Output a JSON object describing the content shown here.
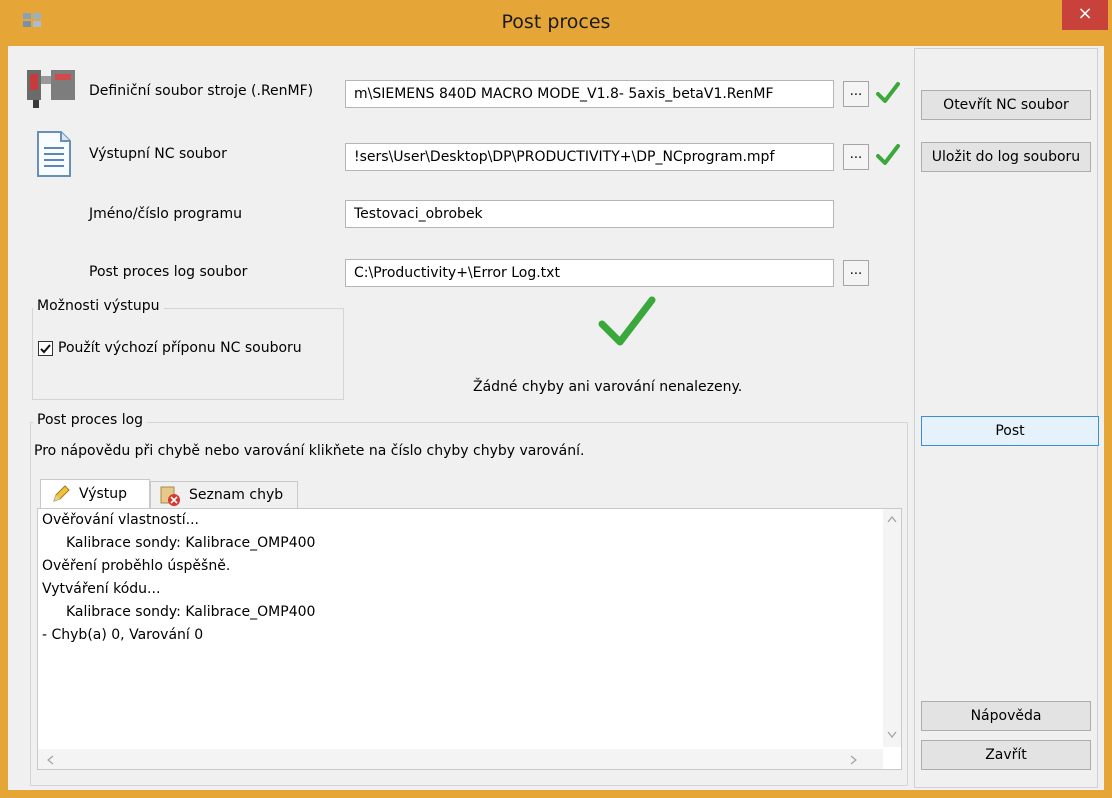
{
  "window": {
    "title": "Post proces",
    "close_label": "×"
  },
  "fields": {
    "machine": {
      "label": "Definiční soubor stroje (.RenMF)",
      "value": "m\\SIEMENS 840D MACRO MODE_V1.8- 5axis_betaV1.RenMF",
      "browse_label": "..."
    },
    "output_nc": {
      "label": "Výstupní NC soubor",
      "value": "!sers\\User\\Desktop\\DP\\PRODUCTIVITY+\\DP_NCprogram.mpf",
      "browse_label": "..."
    },
    "program_name": {
      "label": "Jméno/číslo programu",
      "value": "Testovaci_obrobek"
    },
    "log_file": {
      "label": "Post proces log soubor",
      "value": "C:\\Productivity+\\Error Log.txt",
      "browse_label": "..."
    }
  },
  "output_options": {
    "title": "Možnosti výstupu",
    "checkbox_label": "Použít výchozí příponu NC souboru",
    "checked": true
  },
  "status": {
    "message": "Žádné chyby ani varování nenalezeny."
  },
  "buttons": {
    "open_nc": "Otevřít NC soubor",
    "save_log": "Uložit do log souboru",
    "post": "Post",
    "help": "Nápověda",
    "close": "Zavřít"
  },
  "log": {
    "title": "Post proces log",
    "hint": "Pro nápovědu při chybě nebo varování klikňete na číslo chyby chyby varování.",
    "tabs": [
      {
        "label": "Výstup",
        "icon": "pencil-icon"
      },
      {
        "label": "Seznam chyb",
        "icon": "error-list-icon"
      }
    ],
    "lines": [
      "Ověřování vlastností...",
      "Kalibrace sondy: Kalibrace_OMP400",
      "Ověření proběhlo úspěšně.",
      "Vytváření kódu...",
      "Kalibrace sondy: Kalibrace_OMP400",
      "- Chyb(a) 0, Varování 0"
    ]
  },
  "colors": {
    "titlebar": "#e6a637",
    "close": "#c8413a",
    "check": "#3aa83a",
    "default_button_border": "#3c8dd6"
  }
}
